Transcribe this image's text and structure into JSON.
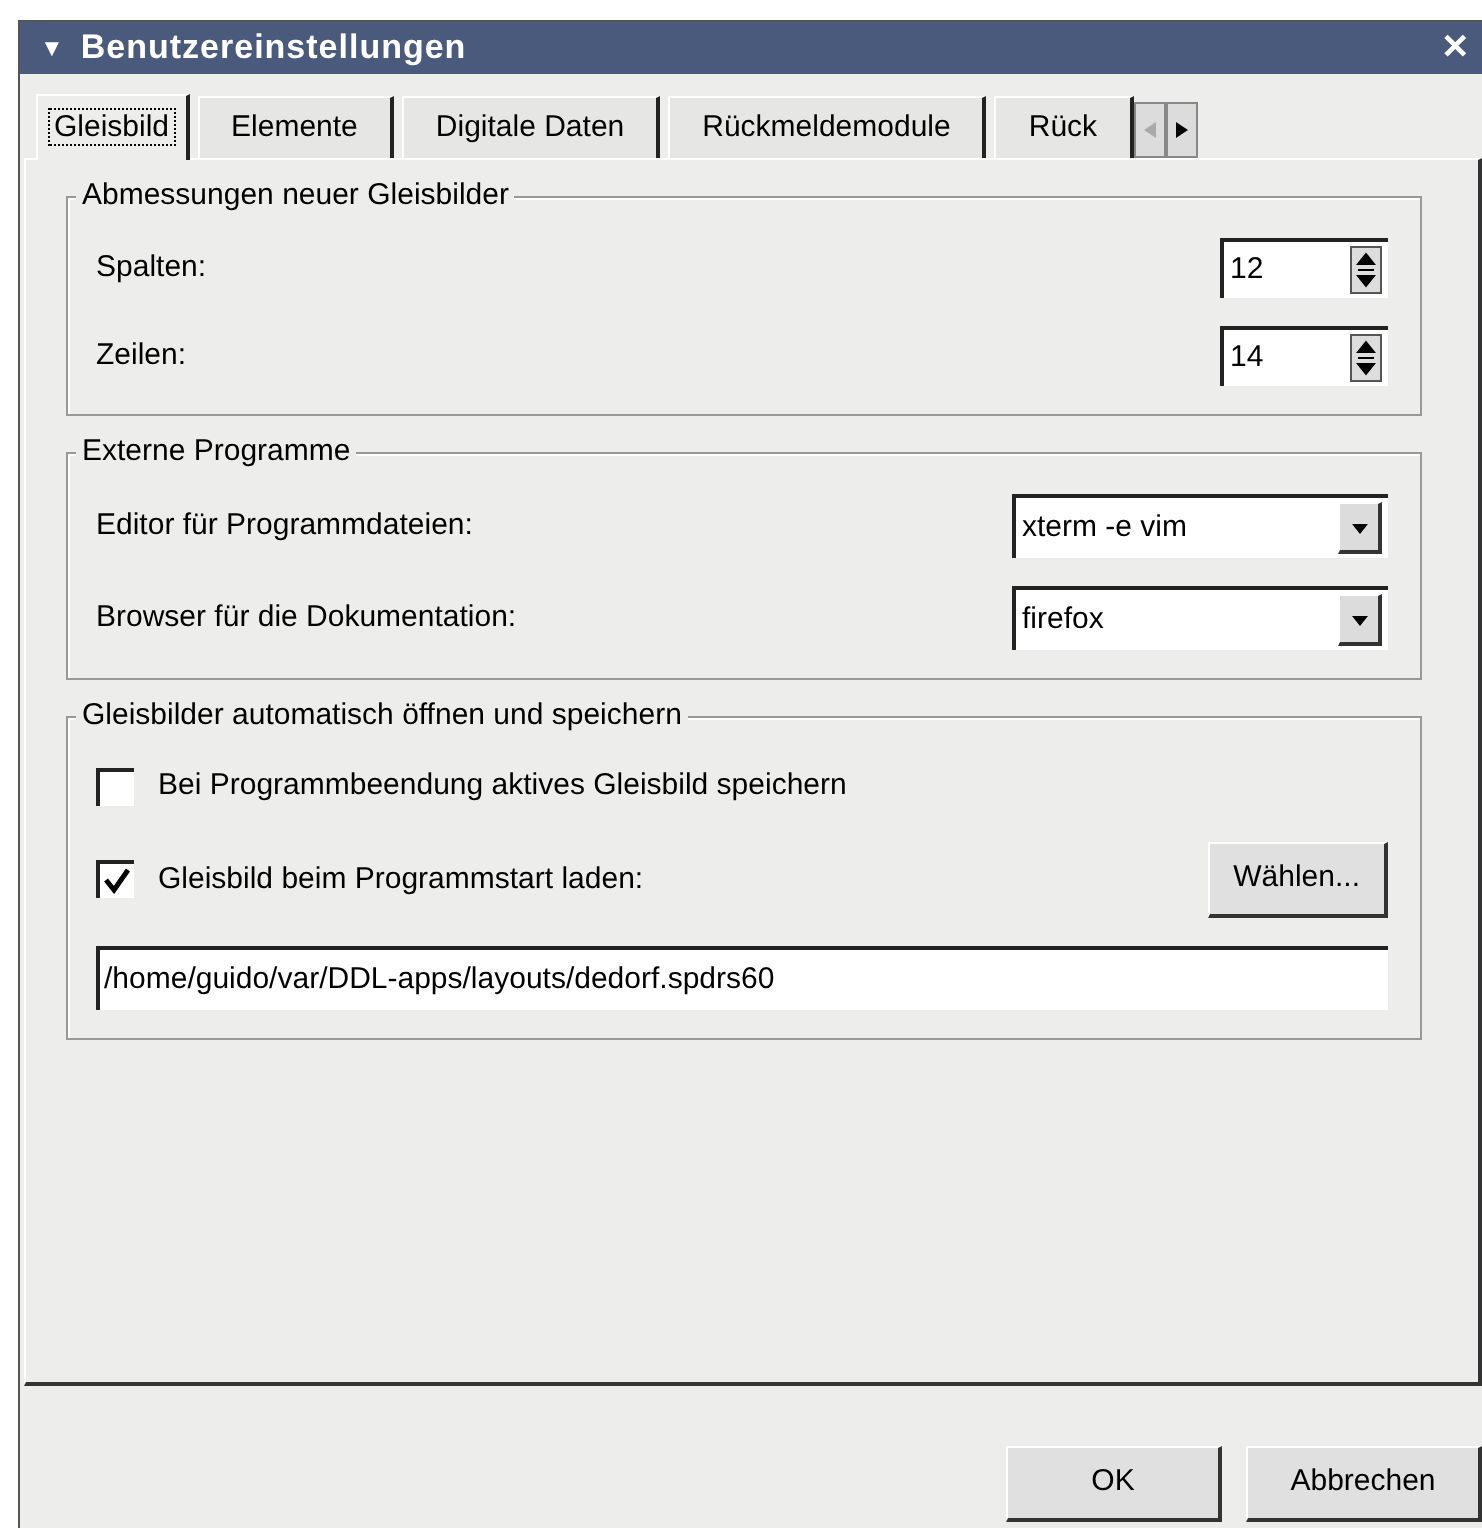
{
  "window": {
    "title": "Benutzereinstellungen",
    "menu_glyph": "▼",
    "close_glyph": "✕"
  },
  "tabs": [
    {
      "label": "Gleisbild",
      "selected": true
    },
    {
      "label": "Elemente",
      "selected": false
    },
    {
      "label": "Digitale Daten",
      "selected": false
    },
    {
      "label": "Rückmeldemodule",
      "selected": false
    },
    {
      "label": "Rück",
      "selected": false
    }
  ],
  "groups": [
    {
      "title": "Abmessungen neuer Gleisbilder",
      "rows": [
        {
          "kind": "spin",
          "label": "Spalten:",
          "value": "12"
        },
        {
          "kind": "spin",
          "label": "Zeilen:",
          "value": "14"
        }
      ]
    },
    {
      "title": "Externe Programme",
      "rows": [
        {
          "kind": "combo",
          "label": "Editor für Programmdateien:",
          "value": "xterm -e vim"
        },
        {
          "kind": "combo",
          "label": "Browser für die Dokumentation:",
          "value": "firefox"
        }
      ]
    },
    {
      "title": "Gleisbilder automatisch öffnen und speichern",
      "rows": [
        {
          "kind": "check",
          "label": "Bei Programmbeendung aktives Gleisbild speichern",
          "checked": false
        },
        {
          "kind": "check",
          "label": "Gleisbild beim Programmstart laden:",
          "checked": true,
          "button": "Wählen..."
        },
        {
          "kind": "text",
          "value": "/home/guido/var/DDL-apps/layouts/dedorf.spdrs60"
        }
      ]
    }
  ],
  "buttons": [
    "OK",
    "Abbrechen"
  ]
}
